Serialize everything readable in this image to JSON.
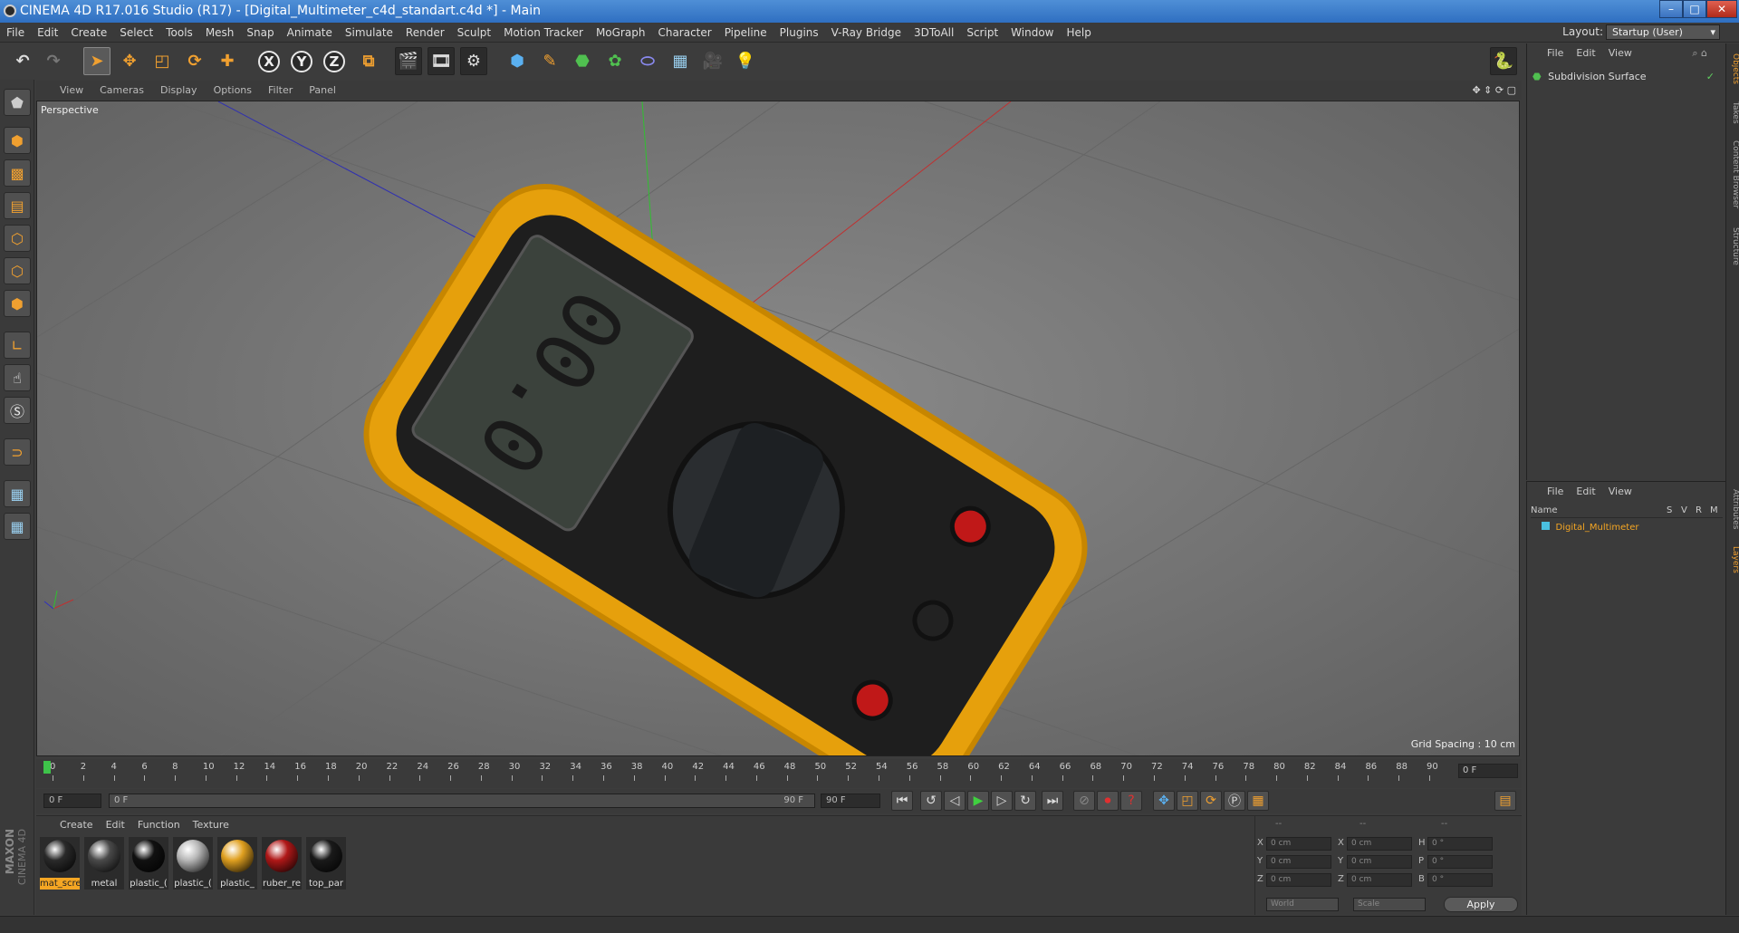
{
  "window": {
    "title": "CINEMA 4D R17.016 Studio (R17) - [Digital_Multimeter_c4d_standart.c4d *] - Main",
    "minimize": "–",
    "maximize": "□",
    "close": "✕"
  },
  "menubar": {
    "items": [
      "File",
      "Edit",
      "Create",
      "Select",
      "Tools",
      "Mesh",
      "Snap",
      "Animate",
      "Simulate",
      "Render",
      "Sculpt",
      "Motion Tracker",
      "MoGraph",
      "Character",
      "Pipeline",
      "Plugins",
      "V-Ray Bridge",
      "3DToAll",
      "Script",
      "Window",
      "Help"
    ],
    "layout_label": "Layout:",
    "layout_value": "Startup (User)"
  },
  "toolbar": {
    "axis_x": "X",
    "axis_y": "Y",
    "axis_z": "Z"
  },
  "viewport": {
    "menu": [
      "View",
      "Cameras",
      "Display",
      "Options",
      "Filter",
      "Panel"
    ],
    "camera_name": "Perspective",
    "grid_spacing": "Grid Spacing : 10 cm"
  },
  "timeline": {
    "ticks": [
      "0",
      "2",
      "4",
      "6",
      "8",
      "10",
      "12",
      "14",
      "16",
      "18",
      "20",
      "22",
      "24",
      "26",
      "28",
      "30",
      "32",
      "34",
      "36",
      "38",
      "40",
      "42",
      "44",
      "46",
      "48",
      "50",
      "52",
      "54",
      "56",
      "58",
      "60",
      "62",
      "64",
      "66",
      "68",
      "70",
      "72",
      "74",
      "76",
      "78",
      "80",
      "82",
      "84",
      "86",
      "88",
      "90"
    ],
    "current_frame_display": "0 F",
    "start_field": "0 F",
    "range_start": "0 F",
    "range_end": "90 F",
    "end_field": "90 F"
  },
  "materials": {
    "menu": [
      "Create",
      "Edit",
      "Function",
      "Texture"
    ],
    "items": [
      {
        "label": "mat_scre",
        "color": "#2a2a2a"
      },
      {
        "label": "metal",
        "color": "#4a4a4a"
      },
      {
        "label": "plastic_(",
        "color": "#111111"
      },
      {
        "label": "plastic_(",
        "color": "#b8b8b8"
      },
      {
        "label": "plastic_",
        "color": "#e0a020"
      },
      {
        "label": "ruber_re",
        "color": "#b01818"
      },
      {
        "label": "top_par",
        "color": "#1a1a1a"
      }
    ]
  },
  "coordinates": {
    "header": [
      "--",
      "--",
      "--"
    ],
    "rows": [
      {
        "pos_label": "X",
        "pos": "0 cm",
        "size_label": "X",
        "size": "0 cm",
        "rot_label": "H",
        "rot": "0 °"
      },
      {
        "pos_label": "Y",
        "pos": "0 cm",
        "size_label": "Y",
        "size": "0 cm",
        "rot_label": "P",
        "rot": "0 °"
      },
      {
        "pos_label": "Z",
        "pos": "0 cm",
        "size_label": "Z",
        "size": "0 cm",
        "rot_label": "B",
        "rot": "0 °"
      }
    ],
    "mode_select": "World",
    "size_select": "Scale",
    "apply": "Apply"
  },
  "object_manager": {
    "menu": [
      "File",
      "Edit",
      "View"
    ],
    "objects": [
      {
        "name": "Subdivision Surface"
      }
    ]
  },
  "layer_manager": {
    "menu": [
      "File",
      "Edit",
      "View"
    ],
    "columns": [
      "Name",
      "S",
      "V",
      "R",
      "M"
    ],
    "objects": [
      {
        "name": "Digital_Multimeter"
      }
    ]
  },
  "side_tabs": [
    "Objects",
    "Takes",
    "Content Browser",
    "Structure",
    "Attributes",
    "Layers"
  ],
  "brand": {
    "line1": "MAXON",
    "line2": "CINEMA 4D"
  },
  "colors": {
    "accent": "#f0a030",
    "selection": "#f5a623",
    "title_bar": "#2f6fc1"
  }
}
